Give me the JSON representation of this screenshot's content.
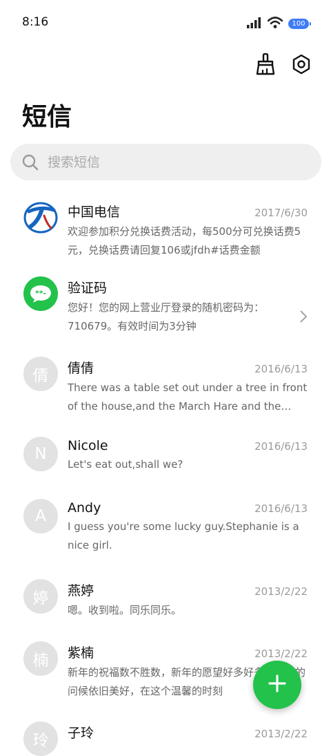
{
  "status": {
    "time": "8:16",
    "battery": "100"
  },
  "header": {
    "title": "短信"
  },
  "icons": {
    "clean": "broom-icon",
    "settings": "settings-icon",
    "search": "search-icon",
    "compose": "plus-icon"
  },
  "colors": {
    "accent_green": "#22c24b",
    "telecom_blue": "#1565c0",
    "battery_blue": "#3e7cf7",
    "avatar_gray": "#e2e2e2"
  },
  "search": {
    "placeholder": "搜索短信"
  },
  "threads": [
    {
      "name": "中国电信",
      "date": "2017/6/30",
      "preview": "欢迎参加积分兑换话费活动，每500分可兑换话费5元，兑换话费请回复106或jfdh#话费金额",
      "avatar": "telecom-logo"
    },
    {
      "name": "验证码",
      "date": "",
      "preview": "您好！您的网上营业厅登录的随机密码为：710679。有效时间为3分钟",
      "avatar": "verification-code-icon"
    },
    {
      "name": "倩倩",
      "date": "2016/6/13",
      "preview": "There was a table set out under a tree in front of the house,and the March Hare and the Hatter",
      "avatar_text": "倩"
    },
    {
      "name": "Nicole",
      "date": "2016/6/13",
      "preview": "Let's eat out,shall we?",
      "avatar_text": "N"
    },
    {
      "name": "Andy",
      "date": "2016/6/13",
      "preview": "I guess you're some lucky guy.Stephanie is a nice girl.",
      "avatar_text": "A"
    },
    {
      "name": "燕婷",
      "date": "2013/2/22",
      "preview": "嗯。收到啦。同乐同乐。",
      "avatar_text": "婷"
    },
    {
      "name": "紫楠",
      "date": "2013/2/22",
      "preview": "新年的祝福数不胜数，新年的愿望好多好多，新年的问候依旧美好，在这个温馨的时刻",
      "avatar_text": "楠"
    },
    {
      "name": "子玲",
      "date": "2013/2/22",
      "preview": "",
      "avatar_text": "玲"
    }
  ]
}
